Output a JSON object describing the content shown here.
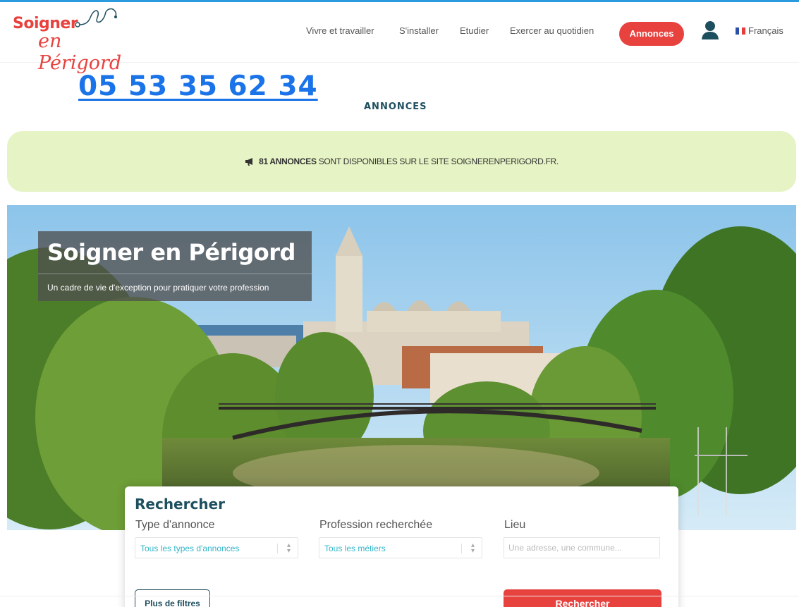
{
  "brand": {
    "line1": "Soigner",
    "line2": "en Périgord",
    "logo_icon": "stethoscope-icon"
  },
  "nav": {
    "items": [
      {
        "label": "Vivre et travailler"
      },
      {
        "label": "S'installer"
      },
      {
        "label": "Etudier"
      },
      {
        "label": "Exercer au quotidien"
      }
    ],
    "active_button": "Annonces",
    "user_icon": "user-icon",
    "language": "Français"
  },
  "phone": "05 53 35 62 34",
  "page_title": "ANNONCES",
  "banner": {
    "icon": "megaphone-icon",
    "count_text": "81 ANNONCES",
    "rest_text": " SONT DISPONIBLES SUR LE SITE SOIGNERENPERIGORD.FR."
  },
  "hero": {
    "title": "Soigner en Périgord",
    "subtitle": "Un cadre de vie d'exception pour pratiquer votre profession"
  },
  "search": {
    "title": "Rechercher",
    "type_label": "Type d'annonce",
    "type_value": "Tous les types d'annonces",
    "profession_label": "Profession recherchée",
    "profession_value": "Tous les métiers",
    "lieu_label": "Lieu",
    "lieu_placeholder": "Une adresse, une commune...",
    "filters_button": "Plus de filtres",
    "submit_button": "Rechercher"
  },
  "colors": {
    "accent_red": "#e8423f",
    "teal_dark": "#1e4f5f",
    "phone_blue": "#1a73e8",
    "banner_green": "#e6f3c4",
    "select_text": "#33b5c8",
    "top_line": "#2b9be0"
  }
}
